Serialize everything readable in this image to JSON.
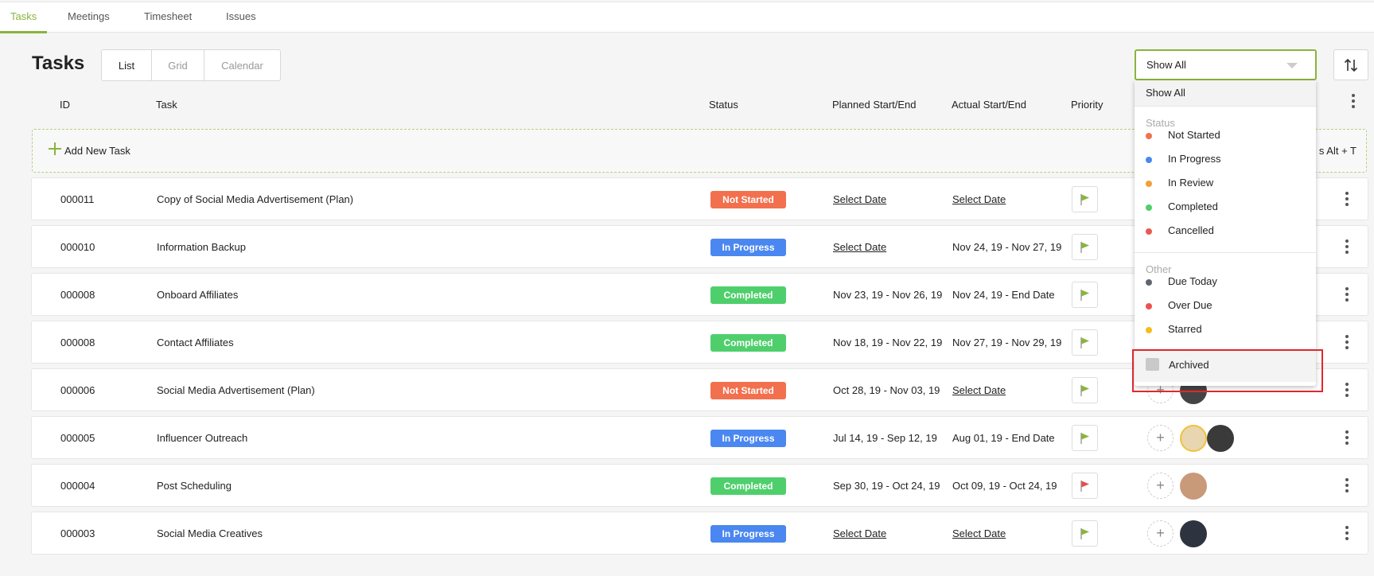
{
  "nav": {
    "tabs": [
      "Tasks",
      "Meetings",
      "Timesheet",
      "Issues"
    ],
    "active": "Tasks"
  },
  "page": {
    "title": "Tasks",
    "views": [
      "List",
      "Grid",
      "Calendar"
    ],
    "active_view": "List"
  },
  "filter": {
    "selected": "Show All"
  },
  "columns": {
    "id": "ID",
    "task": "Task",
    "status": "Status",
    "planned": "Planned Start/End",
    "actual": "Actual Start/End",
    "priority": "Priority"
  },
  "add_task": {
    "label": "Add New Task",
    "hint_visible": "s Alt + T"
  },
  "rows": [
    {
      "id": "000011",
      "task": "Copy of Social Media Advertisement (Plan)",
      "status": "Not Started",
      "planned": "Select Date",
      "actual": "Select Date",
      "flag_color": "#8ab43c"
    },
    {
      "id": "000010",
      "task": "Information Backup",
      "status": "In Progress",
      "planned": "Select Date",
      "actual": "Nov 24, 19 - Nov 27, 19",
      "flag_color": "#8ab43c"
    },
    {
      "id": "000008",
      "task": "Onboard Affiliates",
      "status": "Completed",
      "planned": "Nov 23, 19 - Nov 26, 19",
      "actual": "Nov 24, 19 - End Date",
      "flag_color": "#8ab43c"
    },
    {
      "id": "000008",
      "task": "Contact Affiliates",
      "status": "Completed",
      "planned": "Nov 18, 19 - Nov 22, 19",
      "actual": "Nov 27, 19 - Nov 29, 19",
      "flag_color": "#8ab43c"
    },
    {
      "id": "000006",
      "task": "Social Media Advertisement (Plan)",
      "status": "Not Started",
      "planned": "Oct 28, 19 - Nov 03, 19",
      "actual": "Select Date",
      "flag_color": "#8ab43c"
    },
    {
      "id": "000005",
      "task": "Influencer Outreach",
      "status": "In Progress",
      "planned": "Jul 14, 19 - Sep 12, 19",
      "actual": "Aug 01, 19 - End Date",
      "flag_color": "#8ab43c"
    },
    {
      "id": "000004",
      "task": "Post Scheduling",
      "status": "Completed",
      "planned": "Sep 30, 19 - Oct 24, 19",
      "actual": "Oct 09, 19 - Oct 24, 19",
      "flag_color": "#e84c4c"
    },
    {
      "id": "000003",
      "task": "Social Media Creatives",
      "status": "In Progress",
      "planned": "Select Date",
      "actual": "Select Date",
      "flag_color": "#8ab43c"
    }
  ],
  "status_colors": {
    "Not Started": "#f2704e",
    "In Progress": "#4a87f0",
    "Completed": "#4fcf6c"
  },
  "menu": {
    "show_all": "Show All",
    "status_group": "Status",
    "status_items": [
      {
        "label": "Not Started",
        "color": "#f2704e"
      },
      {
        "label": "In Progress",
        "color": "#4a87f0"
      },
      {
        "label": "In Review",
        "color": "#f0a035"
      },
      {
        "label": "Completed",
        "color": "#4fcf6c"
      },
      {
        "label": "Cancelled",
        "color": "#e85a4f"
      }
    ],
    "other_group": "Other",
    "other_items": [
      {
        "label": "Due Today",
        "color": "#5d6670"
      },
      {
        "label": "Over Due",
        "color": "#ee5050"
      },
      {
        "label": "Starred",
        "color": "#f5bd1b"
      }
    ],
    "archived": "Archived"
  }
}
